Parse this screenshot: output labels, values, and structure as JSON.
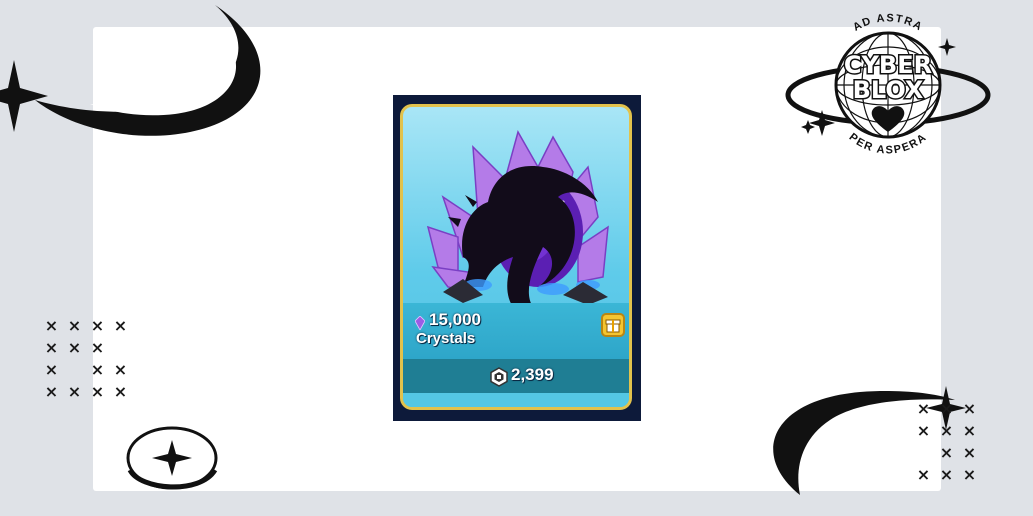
{
  "product": {
    "amount": "15,000",
    "name": "Crystals",
    "price": "2,399",
    "currency_icon": "robux-icon",
    "item_icon": "crystal-icon",
    "gift_icon": "gift-icon"
  },
  "logo": {
    "top_text": "AD ASTRA",
    "line1": "CYBER",
    "line2": "BLOX",
    "bottom_text": "PER ASPERA"
  },
  "decor": {
    "x_mark": "×"
  },
  "colors": {
    "background": "#dfe2e7",
    "card": "#ffffff",
    "frame_gold": "#e2c24c",
    "sky_blue": "#5fcbea",
    "price_band": "#1f7e94",
    "crystal_purple": "#9b5de5",
    "gift_yellow": "#f4c531"
  }
}
